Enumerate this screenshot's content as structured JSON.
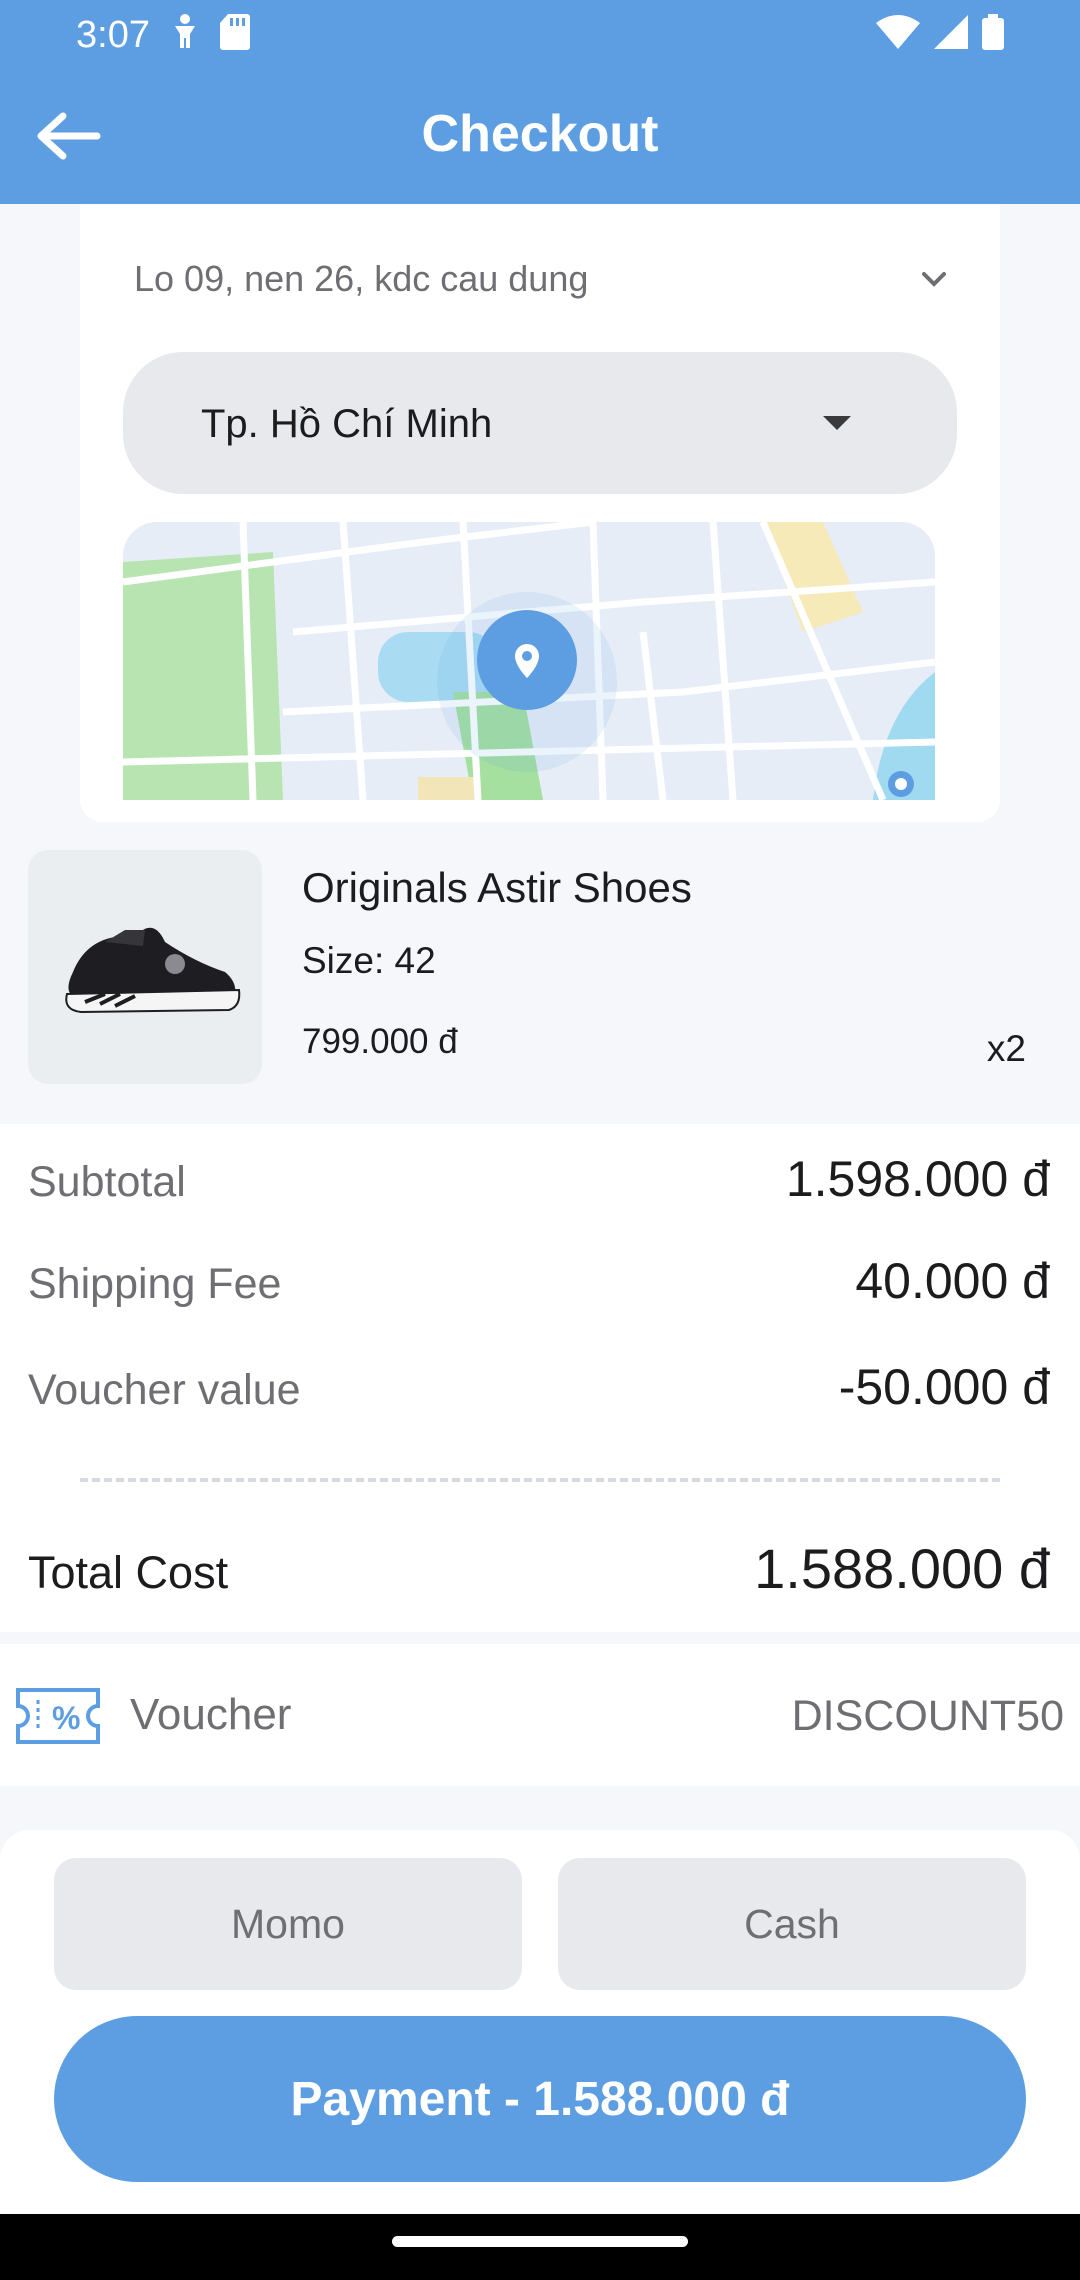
{
  "status": {
    "time": "3:07"
  },
  "header": {
    "title": "Checkout"
  },
  "address": {
    "line": "Lo 09, nen 26, kdc cau dung",
    "city": "Tp. Hồ Chí Minh"
  },
  "product": {
    "name": "Originals Astir Shoes",
    "size": "Size: 42",
    "price": "799.000 đ",
    "qty": "x2"
  },
  "summary": {
    "subtotal_label": "Subtotal",
    "subtotal_value": "1.598.000 đ",
    "shipping_label": "Shipping Fee",
    "shipping_value": "40.000 đ",
    "voucher_label": "Voucher value",
    "voucher_value": "-50.000 đ",
    "total_label": "Total Cost",
    "total_value": "1.588.000 đ"
  },
  "voucher": {
    "label": "Voucher",
    "code": "DISCOUNT50"
  },
  "payment": {
    "methods": [
      "Momo",
      "Cash"
    ],
    "button_label": "Payment - 1.588.000 đ"
  },
  "colors": {
    "primary": "#5d9ee2",
    "muted": "#6e6e73",
    "surface": "#e7e9ec"
  },
  "icons": [
    "back-arrow-icon",
    "chevron-down-icon",
    "caret-down-icon",
    "map-pin-icon",
    "voucher-percent-icon",
    "wifi-icon",
    "signal-icon",
    "battery-icon"
  ]
}
